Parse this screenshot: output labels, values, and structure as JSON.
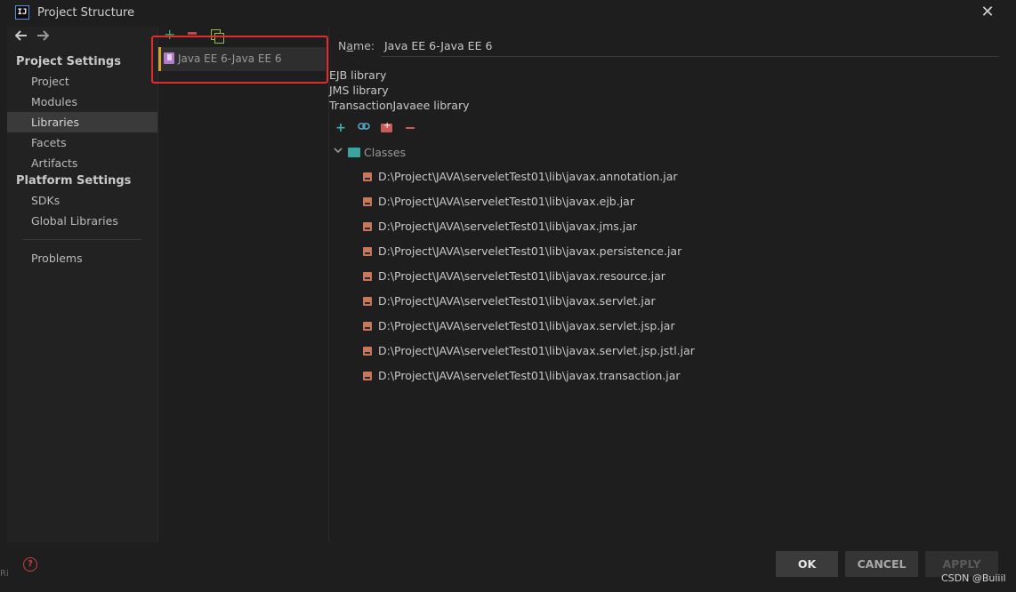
{
  "window": {
    "title": "Project Structure",
    "app_icon_text": "IJ",
    "close_glyph": "✕"
  },
  "nav": {
    "back_glyph": "🡐",
    "forward_glyph": "→"
  },
  "sidebar": {
    "project_settings_header": "Project Settings",
    "project_settings_items": [
      "Project",
      "Modules",
      "Libraries",
      "Facets",
      "Artifacts"
    ],
    "platform_settings_header": "Platform Settings",
    "platform_settings_items": [
      "SDKs",
      "Global Libraries"
    ],
    "problems_label": "Problems",
    "selected": "Libraries"
  },
  "library_list": {
    "add_glyph": "+",
    "items": [
      "Java EE 6-Java EE 6"
    ]
  },
  "details": {
    "name_label_prefix": "N",
    "name_label_underlined": "a",
    "name_label_suffix": "me:",
    "name_value": "Java EE 6-Java EE 6",
    "description_lines": [
      "EJB library",
      "JMS library",
      "TransactionJavaee library"
    ],
    "toolbar": {
      "add_glyph": "+",
      "link_glyph": "⊖"
    },
    "tree": {
      "root_label": "Classes",
      "chevron": "⌄",
      "jars": [
        "D:\\Project\\JAVA\\serveletTest01\\lib\\javax.annotation.jar",
        "D:\\Project\\JAVA\\serveletTest01\\lib\\javax.ejb.jar",
        "D:\\Project\\JAVA\\serveletTest01\\lib\\javax.jms.jar",
        "D:\\Project\\JAVA\\serveletTest01\\lib\\javax.persistence.jar",
        "D:\\Project\\JAVA\\serveletTest01\\lib\\javax.resource.jar",
        "D:\\Project\\JAVA\\serveletTest01\\lib\\javax.servlet.jar",
        "D:\\Project\\JAVA\\serveletTest01\\lib\\javax.servlet.jsp.jar",
        "D:\\Project\\JAVA\\serveletTest01\\lib\\javax.servlet.jsp.jstl.jar",
        "D:\\Project\\JAVA\\serveletTest01\\lib\\javax.transaction.jar"
      ]
    }
  },
  "buttons": {
    "ok": "OK",
    "cancel": "CANCEL",
    "apply": "APPLY",
    "help_glyph": "?"
  },
  "watermark": "CSDN @Buiiil",
  "edge_mark": "Ri",
  "colors": {
    "highlight_box": "#e32b2b",
    "selected_accent": "#d6a32a",
    "jar_icon": "#c8785a"
  }
}
